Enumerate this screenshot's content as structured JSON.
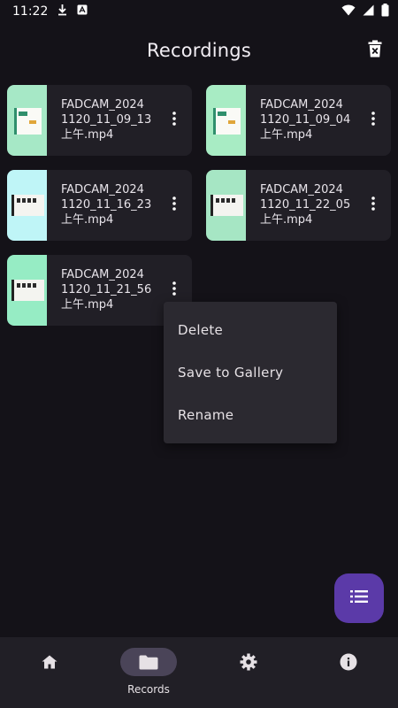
{
  "status_bar": {
    "time": "11:22"
  },
  "app_bar": {
    "title": "Recordings"
  },
  "recordings": [
    {
      "name": "FADCAM_20241120_11_09_13上午.mp4",
      "line1": "FADCAM_2024",
      "line2": "1120_11_09_13",
      "line3": "上午.mp4",
      "thumb_color": "#a6e8c6"
    },
    {
      "name": "FADCAM_20241120_11_09_04上午.mp4",
      "line1": "FADCAM_2024",
      "line2": "1120_11_09_04",
      "line3": "上午.mp4",
      "thumb_color": "#a8ecc4"
    },
    {
      "name": "FADCAM_20241120_11_16_23上午.mp4",
      "line1": "FADCAM_2024",
      "line2": "1120_11_16_23",
      "line3": "上午.mp4",
      "thumb_color": "#bff5f7"
    },
    {
      "name": "FADCAM_20241120_11_22_05上午.mp4",
      "line1": "FADCAM_2024",
      "line2": "1120_11_22_05",
      "line3": "上午.mp4",
      "thumb_color": "#a6e6c4"
    },
    {
      "name": "FADCAM_20241120_11_21_56上午.mp4",
      "line1": "FADCAM_2024",
      "line2": "1120_11_21_56",
      "line3": "上午.mp4",
      "thumb_color": "#96ecc4"
    }
  ],
  "context_menu": {
    "items": [
      "Delete",
      "Save to Gallery",
      "Rename"
    ]
  },
  "bottom_nav": {
    "items": [
      {
        "icon": "home-icon",
        "label": ""
      },
      {
        "icon": "folder-icon",
        "label": "Records",
        "active": true
      },
      {
        "icon": "gear-icon",
        "label": ""
      },
      {
        "icon": "info-icon",
        "label": ""
      }
    ]
  },
  "colors": {
    "background": "#141218",
    "card": "#211f26",
    "menu": "#2b2930",
    "fab": "#5b3aa8",
    "nav_active": "#4a4458"
  }
}
